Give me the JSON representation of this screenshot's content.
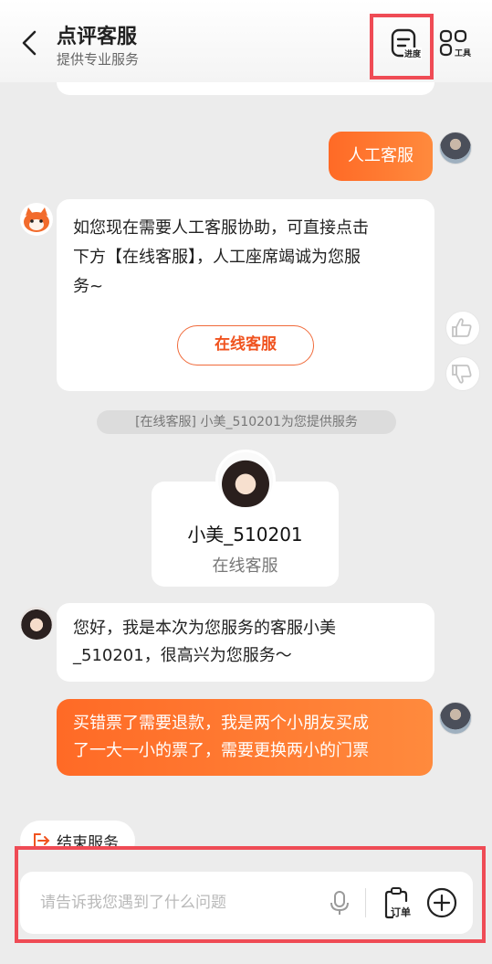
{
  "header": {
    "title": "点评客服",
    "subtitle": "提供专业服务",
    "progress_label": "进度",
    "tools_label": "工具",
    "back_icon": "chevron-left-icon"
  },
  "messages": {
    "user_request": "人工客服",
    "bot_line1": "如您现在需要人工客服协助，可直接点击",
    "bot_line2": "下方【在线客服】，人工座席竭诚为您服",
    "bot_line3": "务~",
    "online_service_button": "在线客服",
    "system_note": "[在线客服] 小美_510201为您提供服务",
    "agent_name": "小美_510201",
    "agent_role": "在线客服",
    "agent_greeting_line1": "您好，我是本次为您服务的客服小美",
    "agent_greeting_line2": "_510201，很高兴为您服务～",
    "user_issue_line1": "买错票了需要退款，我是两个小朋友买成",
    "user_issue_line2": "了一大一小的票了，需要更换两小的门票"
  },
  "actions": {
    "end_service": "结束服务"
  },
  "input": {
    "placeholder": "请告诉我您遇到了什么问题",
    "order_label": "订单"
  },
  "colors": {
    "accent": "#ff6a26",
    "highlight": "#ef4b55",
    "background": "#ececec"
  }
}
